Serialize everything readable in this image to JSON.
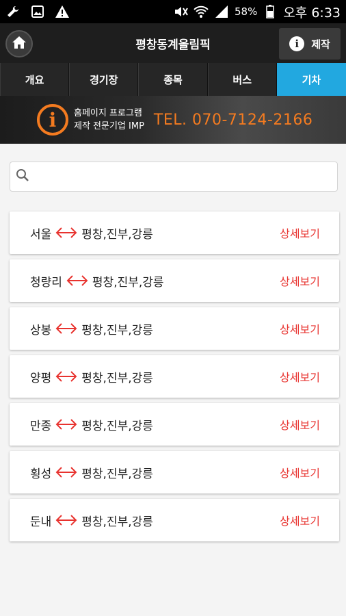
{
  "status": {
    "battery": "58%",
    "time": "오후 6:33"
  },
  "app": {
    "title": "평창동계올림픽",
    "make_label": "제작"
  },
  "tabs": [
    {
      "label": "개요"
    },
    {
      "label": "경기장"
    },
    {
      "label": "종목"
    },
    {
      "label": "버스"
    },
    {
      "label": "기차",
      "active": true
    }
  ],
  "banner": {
    "line1": "홈페이지 프로그램",
    "line2": "제작 전문기업 IMP",
    "tel": "TEL. 070-7124-2166"
  },
  "search": {
    "placeholder": "",
    "value": ""
  },
  "routes": [
    {
      "from": "서울",
      "to": "평창,진부,강릉",
      "detail": "상세보기"
    },
    {
      "from": "청량리",
      "to": "평창,진부,강릉",
      "detail": "상세보기"
    },
    {
      "from": "상봉",
      "to": "평창,진부,강릉",
      "detail": "상세보기"
    },
    {
      "from": "양평",
      "to": "평창,진부,강릉",
      "detail": "상세보기"
    },
    {
      "from": "만종",
      "to": "평창,진부,강릉",
      "detail": "상세보기"
    },
    {
      "from": "횡성",
      "to": "평창,진부,강릉",
      "detail": "상세보기"
    },
    {
      "from": "둔내",
      "to": "평창,진부,강릉",
      "detail": "상세보기"
    }
  ],
  "colors": {
    "accent": "#22a8e0",
    "arrow": "#e8332f",
    "banner_orange": "#f47b20"
  }
}
